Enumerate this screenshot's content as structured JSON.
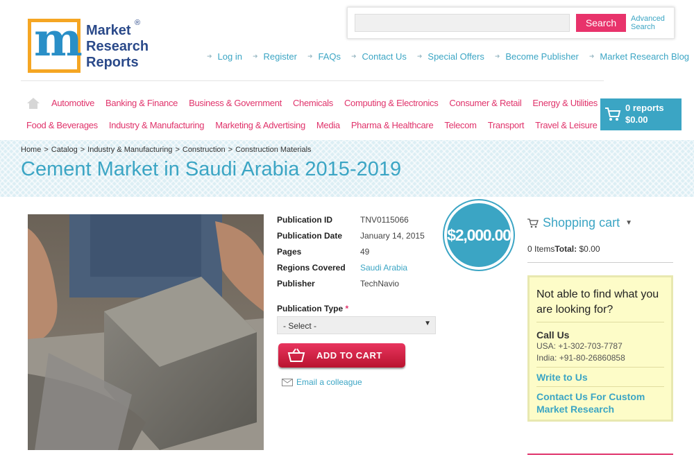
{
  "logo": {
    "lines": [
      "Market",
      "Research",
      "Reports"
    ],
    "reg": "®",
    "letter": "m"
  },
  "search": {
    "button_label": "Search",
    "advanced_label": "Advanced Search",
    "placeholder": ""
  },
  "top_links": [
    "Log in",
    "Register",
    "FAQs",
    "Contact Us",
    "Special Offers",
    "Become Publisher",
    "Market Research Blog"
  ],
  "categories_row1": [
    "Automotive",
    "Banking & Finance",
    "Business & Government",
    "Chemicals",
    "Computing & Electronics",
    "Consumer & Retail",
    "Energy & Utilities"
  ],
  "categories_row2": [
    "Food & Beverages",
    "Industry & Manufacturing",
    "Marketing & Advertising",
    "Media",
    "Pharma & Healthcare",
    "Telecom",
    "Transport",
    "Travel & Leisure"
  ],
  "cart_button": {
    "reports": "0 reports",
    "amount": "$0.00"
  },
  "breadcrumb": [
    "Home",
    "Catalog",
    "Industry & Manufacturing",
    "Construction",
    "Construction Materials"
  ],
  "page_title": "Cement Market in Saudi Arabia 2015-2019",
  "details": [
    {
      "label": "Publication ID",
      "value": "TNV0115066"
    },
    {
      "label": "Publication Date",
      "value": "January 14, 2015"
    },
    {
      "label": "Pages",
      "value": "49"
    },
    {
      "label": "Regions Covered",
      "value": "Saudi Arabia"
    },
    {
      "label": "Publisher",
      "value": "TechNavio"
    }
  ],
  "price": "$2,000.00",
  "publication_type": {
    "label": "Publication Type",
    "required_mark": "*",
    "selected": "- Select -"
  },
  "add_to_cart_label": "ADD TO CART",
  "email_colleague_label": "Email a colleague",
  "shopping_cart": {
    "title": "Shopping cart",
    "items": "0 Items",
    "total_label": "Total:",
    "total_value": "$0.00"
  },
  "help_box": {
    "title": "Not able to find what you are looking for?",
    "call_label": "Call Us",
    "phone_usa": "USA: +1-302-703-7787",
    "phone_india": "India: +91-80-26860858",
    "write_label": "Write to Us",
    "custom_label": "Contact Us For Custom Market Research"
  },
  "colors": {
    "accent_blue": "#3ba5c4",
    "accent_pink": "#e0336b",
    "logo_orange": "#f5a623",
    "logo_navy": "#2b4a8a"
  }
}
